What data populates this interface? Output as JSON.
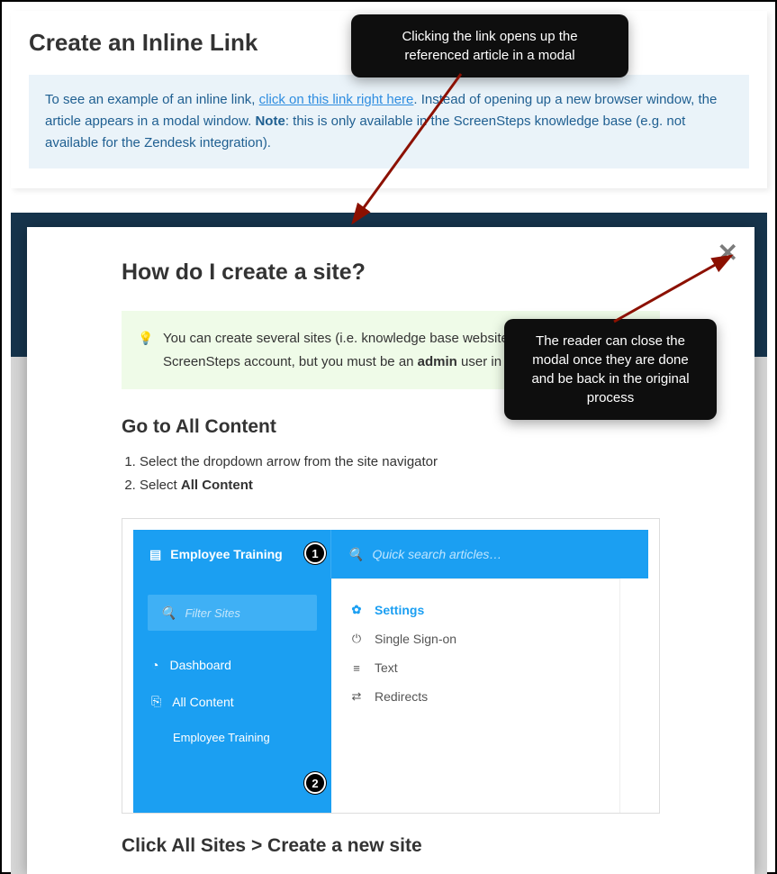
{
  "top_card": {
    "title": "Create an Inline Link",
    "info_text_before": "To see an example of an inline link, ",
    "info_link": "click on this link right here",
    "info_text_after": ". Instead of opening up a new browser window, the article appears in a modal window. ",
    "info_note_label": "Note",
    "info_note_text": ": this is only available in the ScreenSteps knowledge base (e.g. not available for the Zendesk integration)."
  },
  "callouts": {
    "c1": "Clicking the link opens up the referenced article in a modal",
    "c2": "The reader can close the modal once they are done and be back in the original process"
  },
  "modal": {
    "close": "✕",
    "title": "How do I create a site?",
    "tip_before": "You can create several sites (i.e. knowledge base websites) on a single ScreenSteps account, but you must be an ",
    "tip_bold": "admin",
    "tip_after": " user in order to create a site.",
    "section1": "Go to All Content",
    "step1": "Select the dropdown arrow from the site navigator",
    "step2_before": "Select ",
    "step2_bold": "All Content",
    "section2": "Click All Sites > Create a new site"
  },
  "app": {
    "header_left": "Employee Training",
    "header_search_placeholder": "Quick search articles…",
    "filter_placeholder": "Filter Sites",
    "side_dashboard": "Dashboard",
    "side_all_content": "All Content",
    "side_sub_employee": "Employee Training",
    "panel_settings": "Settings",
    "panel_sso": "Single Sign-on",
    "panel_text": "Text",
    "panel_redirects": "Redirects",
    "badge1": "1",
    "badge2": "2"
  }
}
